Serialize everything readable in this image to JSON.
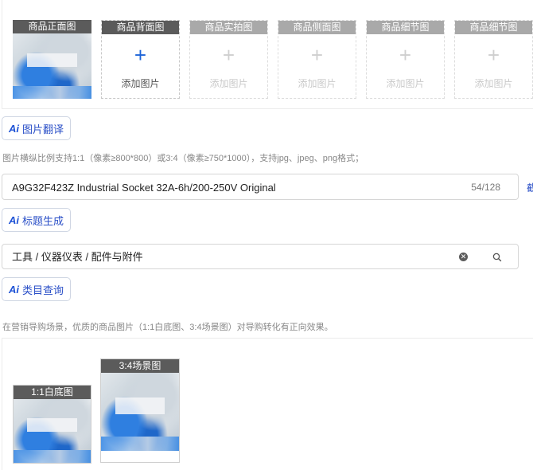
{
  "image_slots": [
    {
      "label": "商品正面图",
      "state": "filled"
    },
    {
      "label": "商品背面图",
      "state": "active",
      "add_text": "添加图片"
    },
    {
      "label": "商品实拍图",
      "state": "disabled",
      "add_text": "添加图片"
    },
    {
      "label": "商品侧面图",
      "state": "disabled",
      "add_text": "添加图片"
    },
    {
      "label": "商品细节图",
      "state": "disabled",
      "add_text": "添加图片"
    },
    {
      "label": "商品细节图",
      "state": "disabled",
      "add_text": "添加图片"
    }
  ],
  "image_translate": {
    "ai": "Ai",
    "label": "图片翻译"
  },
  "image_hint": "图片横纵比例支持1:1（像素≥800*800）或3:4（像素≥750*1000），支持jpg、jpeg、png格式；",
  "title_field": {
    "value": "A9G32F423Z Industrial Socket 32A-6h/200-250V Original",
    "counter": "54/128",
    "edge_char": "截"
  },
  "title_generate": {
    "ai": "Ai",
    "label": "标题生成"
  },
  "category_field": {
    "value": "工具 / 仪器仪表 / 配件与附件"
  },
  "category_query": {
    "ai": "Ai",
    "label": "类目查询"
  },
  "marketing_hint": "在营销导购场景，优质的商品图片（1:1白底图、3:4场景图）对导购转化有正向效果。",
  "marketing_images": [
    {
      "label": "1:1白底图"
    },
    {
      "label": "3:4场景图"
    }
  ],
  "colors": {
    "accent": "#1d64d8",
    "header_bg": "#5b5b5b"
  }
}
